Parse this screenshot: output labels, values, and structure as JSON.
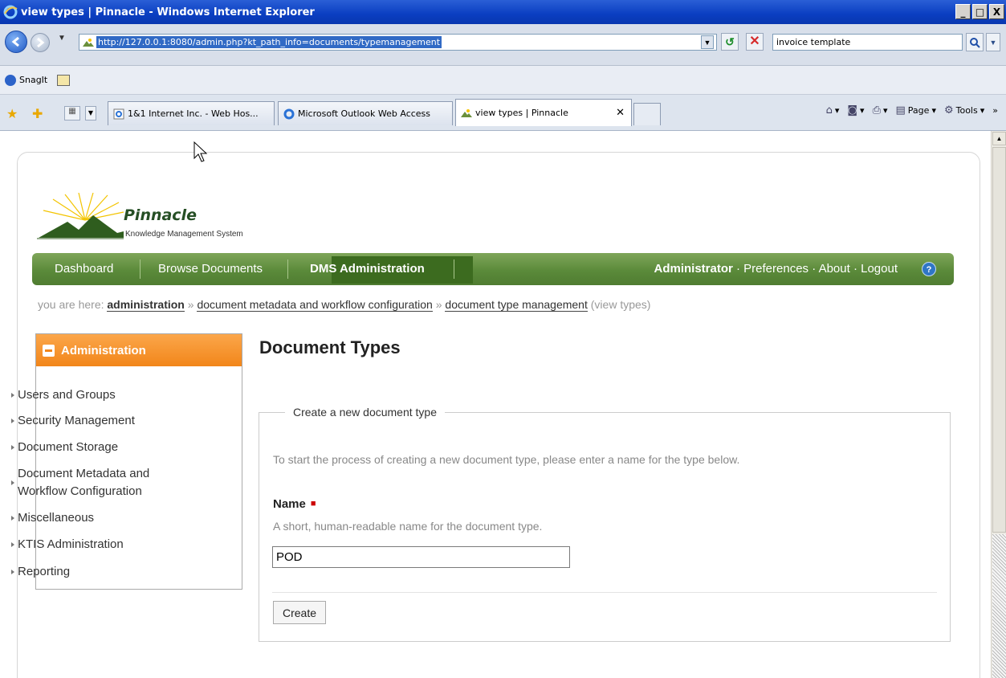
{
  "window": {
    "title": "view types | Pinnacle - Windows Internet Explorer",
    "buttons": [
      "_",
      "□",
      "X"
    ]
  },
  "browser": {
    "url": "http://127.0.0.1:8080/admin.php?kt_path_info=documents/typemanagement",
    "search_value": "invoice template",
    "toolbar_snagit": "SnagIt",
    "tabs": [
      {
        "label": "1&1 Internet Inc. - Web Hos..."
      },
      {
        "label": "Microsoft Outlook Web Access"
      },
      {
        "label": "view types | Pinnacle",
        "active": true
      }
    ],
    "commands": {
      "page": "Page",
      "tools": "Tools"
    }
  },
  "colors": {
    "nav_green": "#5b8a3a",
    "admin_orange": "#f2861a",
    "ie_blue": "#0a3ec1"
  },
  "app": {
    "logo_name": "Pinnacle",
    "logo_sub": "Knowledge Management System",
    "nav": {
      "dashboard": "Dashboard",
      "browse": "Browse Documents",
      "dms_admin": "DMS Administration",
      "user": "Administrator",
      "preferences": "Preferences",
      "about": "About",
      "logout": "Logout",
      "sep": "·"
    },
    "breadcrumb": {
      "prefix": "you are here:",
      "items": [
        "administration",
        "document metadata and workflow configuration",
        "document type management"
      ],
      "sep": "»",
      "current": "(view types)"
    },
    "sidebar": {
      "title": "Administration",
      "items": [
        {
          "label": "Users and Groups"
        },
        {
          "label": "Security Management"
        },
        {
          "label": "Document Storage"
        },
        {
          "label": "Document Metadata and\nWorkflow Configuration"
        },
        {
          "label": "Miscellaneous"
        },
        {
          "label": "KTIS Administration"
        },
        {
          "label": "Reporting"
        }
      ]
    },
    "main": {
      "title": "Document Types",
      "legend": "Create a new document type",
      "intro": "To start the process of creating a new document type, please enter a name for the type below.",
      "name_label": "Name",
      "required_mark": "■",
      "name_help": "A short, human-readable name for the document type.",
      "name_value": "POD",
      "create_label": "Create"
    }
  }
}
